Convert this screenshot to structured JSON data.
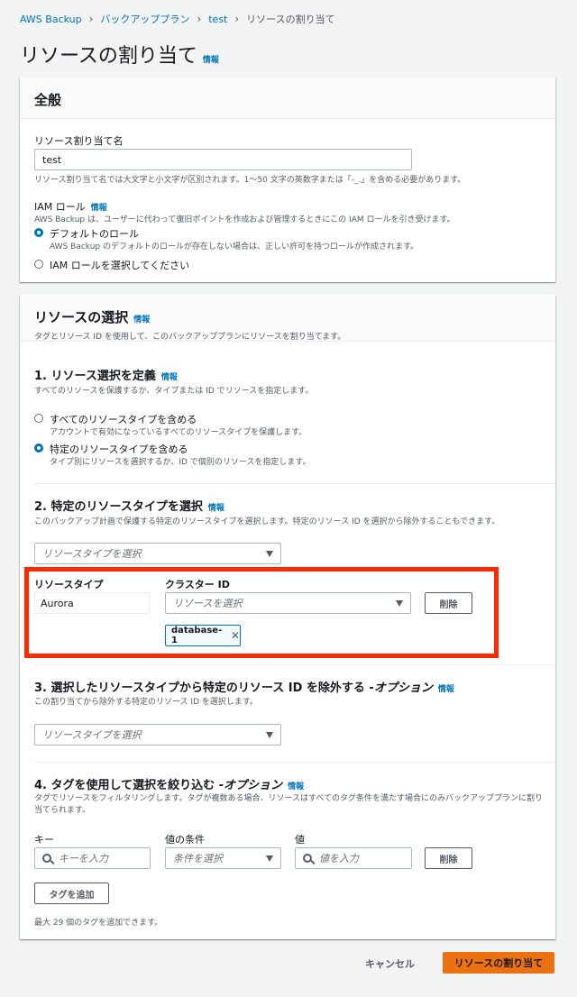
{
  "breadcrumb": [
    {
      "label": "AWS Backup"
    },
    {
      "label": "バックアッププラン"
    },
    {
      "label": "test"
    },
    {
      "label": "リソースの割り当て"
    }
  ],
  "page": {
    "title": "リソースの割り当て",
    "info": "情報"
  },
  "general": {
    "title": "全般",
    "name_label": "リソース割り当て名",
    "name_value": "test",
    "name_hint": "リソース割り当て名では大文字と小文字が区別されます。1〜50 文字の英数字または「-_.」を含める必要があります。",
    "iam_label": "IAM ロール",
    "iam_info": "情報",
    "iam_desc": "AWS Backup は、ユーザーに代わって復旧ポイントを作成および管理するときにこの IAM ロールを引き受けます。",
    "opt_default": "デフォルトのロール",
    "opt_default_desc": "AWS Backup のデフォルトのロールが存在しない場合は、正しい許可を持つロールが作成されます。",
    "opt_choose": "IAM ロールを選択してください"
  },
  "selection": {
    "title": "リソースの選択",
    "info": "情報",
    "desc": "タグとリソース ID を使用して、このバックアッププランにリソースを割り当てます。",
    "s1": {
      "title": "1. リソース選択を定義",
      "info": "情報",
      "desc": "すべてのリソースを保護するか、タイプまたは ID でリソースを指定します。",
      "opt_all": "すべてのリソースタイプを含める",
      "opt_all_desc": "アカウントで有効になっているすべてのリソースタイプを保護します。",
      "opt_specific": "特定のリソースタイプを含める",
      "opt_specific_desc": "タイプ別にリソースを選択するか、ID で個別のリソースを指定します。"
    },
    "s2": {
      "title": "2. 特定のリソースタイプを選択",
      "info": "情報",
      "desc": "このバックアップ計画で保護する特定のリソースタイプを選択します。特定のリソース ID を選択から除外することもできます。",
      "select_placeholder": "リソースタイプを選択",
      "col_type": "リソースタイプ",
      "col_cluster": "クラスター ID",
      "type_value": "Aurora",
      "cluster_placeholder": "リソースを選択",
      "remove": "削除",
      "token": "database-1",
      "highlight_color": "#ff2a00"
    },
    "s3": {
      "title_main": "3. 選択したリソースタイプから特定のリソース ID を除外する - ",
      "title_opt": "オプション",
      "info": "情報",
      "desc": "この割り当てから除外する特定のリソース ID を選択します。",
      "select_placeholder": "リソースタイプを選択"
    },
    "s4": {
      "title_main": "4. タグを使用して選択を絞り込む - ",
      "title_opt": "オプション",
      "info": "情報",
      "desc": "タグでリソースをフィルタリングします。タグが複数ある場合、リソースはすべてのタグ条件を満たす場合にのみバックアッププランに割り当てられます。",
      "key_label": "キー",
      "key_placeholder": "キーを入力",
      "cond_label": "値の条件",
      "cond_placeholder": "条件を選択",
      "val_label": "値",
      "val_placeholder": "値を入力",
      "remove": "削除",
      "add_tag": "タグを追加",
      "max_note": "最大 29 個のタグを追加できます。"
    }
  },
  "footer": {
    "cancel": "キャンセル",
    "submit": "リソースの割り当て",
    "submit_color": "#ec7211"
  }
}
